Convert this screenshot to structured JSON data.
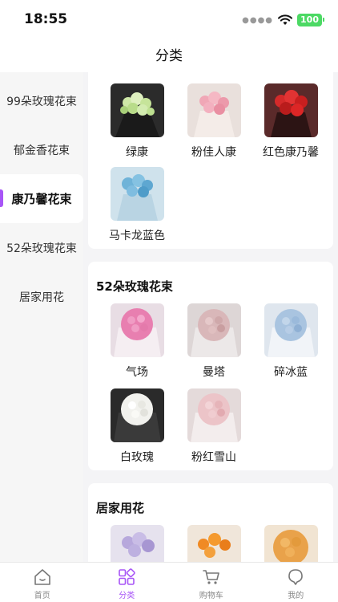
{
  "status_bar": {
    "time": "18:55",
    "battery": "100"
  },
  "nav": {
    "title": "分类"
  },
  "sidebar": {
    "items": [
      {
        "label": "99朵玫瑰花束"
      },
      {
        "label": "郁金香花束"
      },
      {
        "label": "康乃馨花束",
        "active": true
      },
      {
        "label": "52朵玫瑰花束"
      },
      {
        "label": "居家用花"
      }
    ]
  },
  "sections": [
    {
      "title": "",
      "products": [
        {
          "name": "绿康"
        },
        {
          "name": "粉佳人康"
        },
        {
          "name": "红色康乃馨"
        },
        {
          "name": "马卡龙蓝色"
        }
      ]
    },
    {
      "title": "52朵玫瑰花束",
      "products": [
        {
          "name": "气场"
        },
        {
          "name": "曼塔"
        },
        {
          "name": "碎冰蓝"
        },
        {
          "name": "白玫瑰"
        },
        {
          "name": "粉红雪山"
        }
      ]
    },
    {
      "title": "居家用花",
      "products": [
        {
          "name": ""
        },
        {
          "name": ""
        },
        {
          "name": ""
        }
      ]
    }
  ],
  "tab_bar": {
    "tabs": [
      {
        "label": "首页",
        "icon": "home-icon"
      },
      {
        "label": "分类",
        "icon": "category-icon",
        "active": true
      },
      {
        "label": "购物车",
        "icon": "cart-icon"
      },
      {
        "label": "我的",
        "icon": "profile-icon"
      }
    ]
  },
  "colors": {
    "accent": "#a855f7",
    "battery": "#4cd964",
    "sidebar_bg": "#f6f6f6",
    "content_bg": "#f4f4f6"
  }
}
